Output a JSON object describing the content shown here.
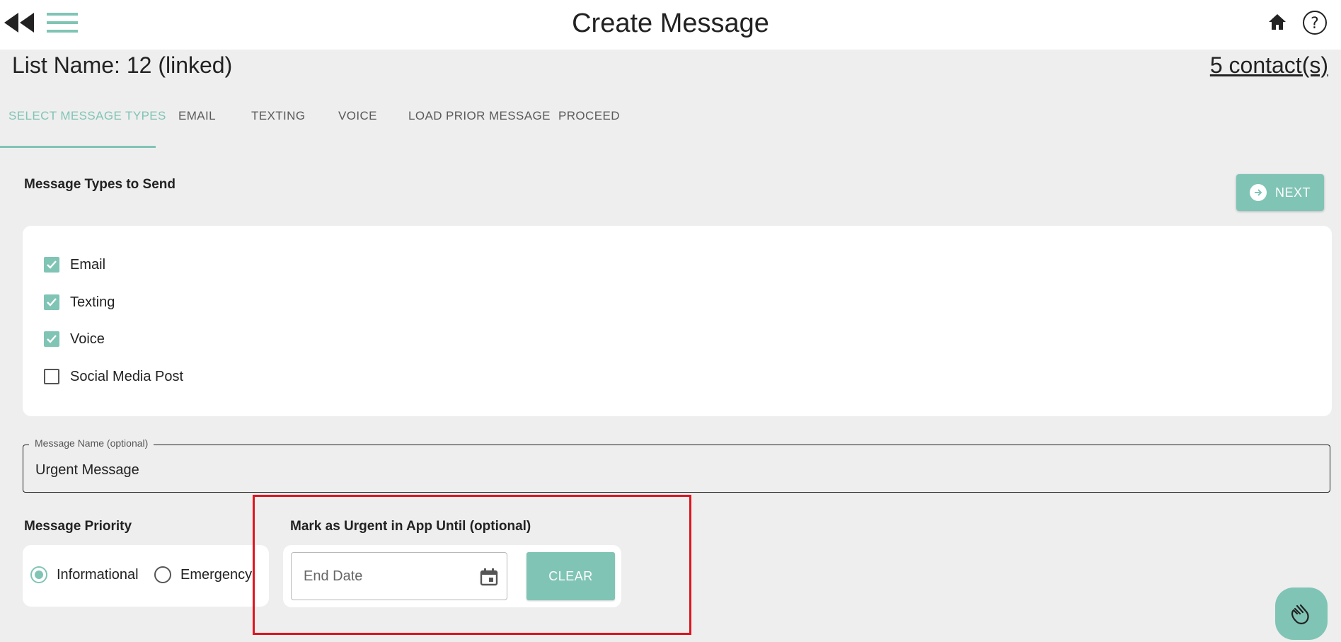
{
  "header": {
    "title": "Create Message",
    "icons": {
      "back": "rewind-icon",
      "menu": "hamburger-menu-icon",
      "home": "home-icon",
      "help": "help-icon"
    }
  },
  "list": {
    "name": "List Name: 12 (linked)",
    "contacts": "5 contact(s)"
  },
  "tabs": [
    {
      "label": "SELECT MESSAGE TYPES",
      "active": true
    },
    {
      "label": "EMAIL",
      "active": false
    },
    {
      "label": "TEXTING",
      "active": false
    },
    {
      "label": "VOICE",
      "active": false
    },
    {
      "label": "LOAD PRIOR MESSAGE",
      "active": false
    },
    {
      "label": "PROCEED",
      "active": false
    }
  ],
  "message_types": {
    "heading": "Message Types to Send",
    "next_label": "NEXT",
    "options": [
      {
        "label": "Email",
        "checked": true
      },
      {
        "label": "Texting",
        "checked": true
      },
      {
        "label": "Voice",
        "checked": true
      },
      {
        "label": "Social Media Post",
        "checked": false
      }
    ]
  },
  "message_name": {
    "label": "Message Name (optional)",
    "value": "Urgent Message"
  },
  "priority": {
    "heading": "Message Priority",
    "options": [
      {
        "label": "Informational",
        "selected": true
      },
      {
        "label": "Emergency",
        "selected": false
      }
    ]
  },
  "urgent": {
    "heading": "Mark as Urgent in App Until (optional)",
    "end_date_placeholder": "End Date",
    "clear_label": "CLEAR"
  },
  "colors": {
    "accent": "#80c4b5",
    "highlight": "#e0141e",
    "background": "#eeeeee"
  }
}
